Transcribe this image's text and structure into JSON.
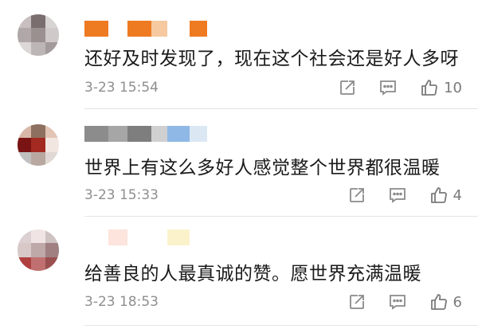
{
  "comments": [
    {
      "text": "还好及时发现了，现在这个社会还是好人多呀",
      "time": "3-23 15:54",
      "likes": "10",
      "avatar_colors": [
        "#c8c0c0",
        "#7a6e6e",
        "#d8d4d4",
        "#b0a8a8",
        "#9a9090",
        "#cfc9c9",
        "#dcd8d8",
        "#bdb6b6",
        "#a39b9b"
      ],
      "username_colors": [
        "#ee7a22",
        "#ffffff",
        "#ee7a22",
        "#f6c9a0",
        "#ffffff",
        "#ee7a22"
      ]
    },
    {
      "text": "世界上有这么多好人感觉整个世界都很温暖",
      "time": "3-23 15:33",
      "likes": "4",
      "avatar_colors": [
        "#d8b7a8",
        "#8e7060",
        "#e2c4b4",
        "#7a1414",
        "#a32a20",
        "#f2e6e0",
        "#c0c0c0",
        "#b8a8a0",
        "#e0d8d4"
      ],
      "username_colors": [
        "#8c8c8c",
        "#a6a6a6",
        "#7e7e7e",
        "#d0d0d0",
        "#8fb8e6",
        "#dbe8f4"
      ]
    },
    {
      "text": "给善良的人最真诚的赞。愿世界充满温暖",
      "time": "3-23 18:53",
      "likes": "6",
      "avatar_colors": [
        "#dcd0d0",
        "#f0e4e4",
        "#cfc2c2",
        "#d8c8c8",
        "#bfa8a8",
        "#a08080",
        "#b04040",
        "#c07070",
        "#9a5050"
      ],
      "username_colors": [
        "#ffffff",
        "#fde4dc",
        "#ffffff",
        "#ffffff",
        "#fbf2cc",
        "#ffffff"
      ]
    }
  ],
  "icons": {
    "share": "share-icon",
    "reply": "comment-icon",
    "like": "thumbs-up-icon"
  }
}
